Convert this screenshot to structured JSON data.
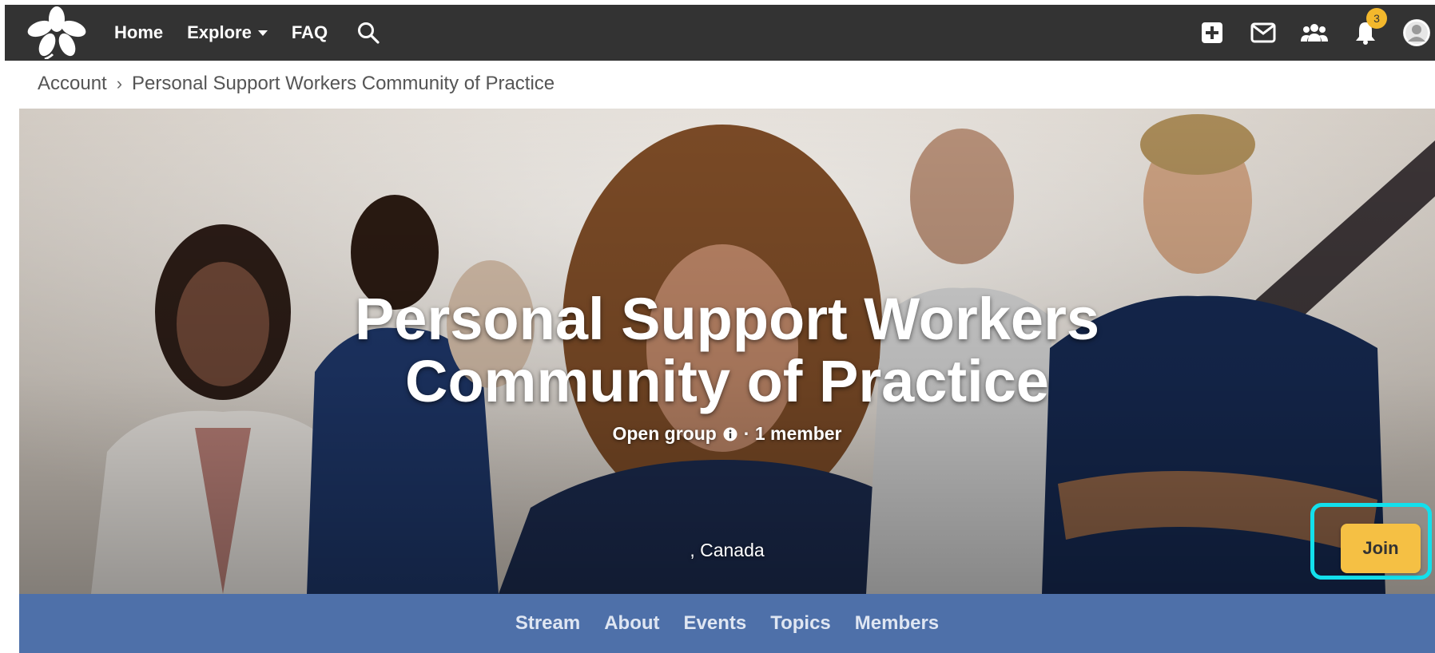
{
  "navbar": {
    "links": {
      "home": "Home",
      "explore": "Explore",
      "faq": "FAQ"
    },
    "notification_count": "3",
    "colors": {
      "background": "#333333",
      "badge": "#f3b82c"
    }
  },
  "breadcrumb": {
    "account": "Account",
    "separator": "›",
    "current": "Personal Support Workers Community of Practice"
  },
  "hero": {
    "title_line1": "Personal Support Workers",
    "title_line2": "Community of Practice",
    "group_type": "Open group",
    "member_count": "· 1 member",
    "location": ", Canada",
    "join_label": "Join",
    "colors": {
      "join": "#f5c044",
      "highlight": "#13e0ec"
    }
  },
  "tabs": {
    "stream": "Stream",
    "about": "About",
    "events": "Events",
    "topics": "Topics",
    "members": "Members",
    "color": "#4e70a9"
  },
  "icons": [
    "flower-logo-icon",
    "search-icon",
    "plus-icon",
    "mail-icon",
    "group-icon",
    "bell-icon",
    "user-icon",
    "info-icon"
  ]
}
